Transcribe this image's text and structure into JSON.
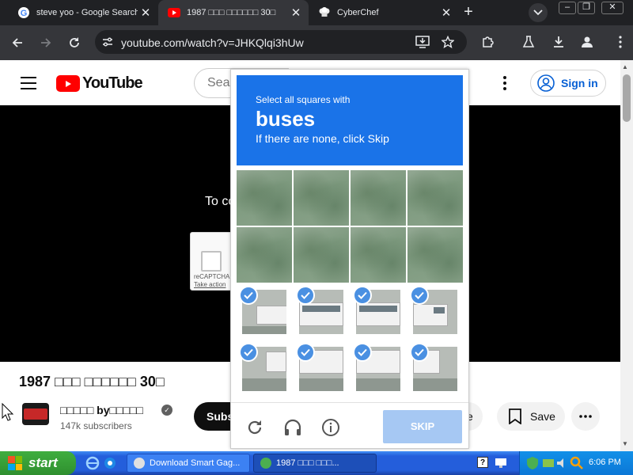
{
  "browser": {
    "tabs": [
      {
        "label": "steve yoo - Google Search"
      },
      {
        "label": "1987 □□□ □□□□□□ 30□"
      },
      {
        "label": "CyberChef"
      }
    ],
    "url": "youtube.com/watch?v=JHKQlqi3hUw"
  },
  "youtube": {
    "search_placeholder": "Search",
    "sign_in_label": "Sign in",
    "player_message": "To co",
    "mini_recaptcha": {
      "brand": "reCAPTCHA",
      "action": "Take action"
    },
    "video_title": "1987 □□□ □□□□□□ 30□",
    "channel_name": "□□□□□ by□□□□□",
    "subscribers": "147k subscribers",
    "subscribe_label": "Subs",
    "share_label": "e",
    "save_label": "Save"
  },
  "captcha": {
    "instruction": "Select all squares with",
    "target": "buses",
    "hint": "If there are none, click Skip",
    "tiles_selected": [
      false,
      false,
      false,
      false,
      false,
      false,
      false,
      false,
      true,
      true,
      true,
      true,
      true,
      true,
      true,
      true
    ],
    "skip_label": "SKIP",
    "accent_color": "#1a73e8"
  },
  "taskbar": {
    "start_label": "start",
    "tasks": [
      {
        "label": "Download Smart Gag..."
      },
      {
        "label": "1987 □□□ □□□..."
      }
    ],
    "clock": "6:06 PM"
  }
}
